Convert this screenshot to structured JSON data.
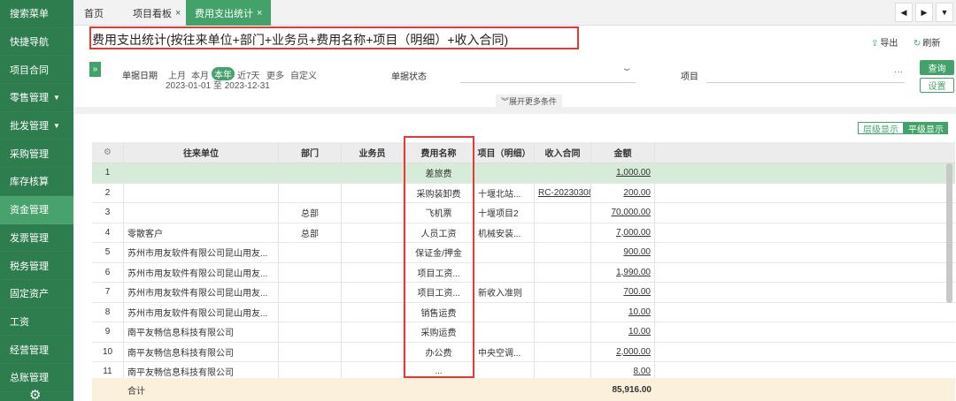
{
  "sidebar": {
    "items": [
      {
        "label": "搜索菜单",
        "caret": false,
        "active": false
      },
      {
        "label": "快捷导航",
        "caret": false,
        "active": false
      },
      {
        "label": "项目合同",
        "caret": false,
        "active": false
      },
      {
        "label": "零售管理",
        "caret": true,
        "active": false
      },
      {
        "label": "批发管理",
        "caret": true,
        "active": false
      },
      {
        "label": "采购管理",
        "caret": false,
        "active": false
      },
      {
        "label": "库存核算",
        "caret": false,
        "active": false
      },
      {
        "label": "资金管理",
        "caret": false,
        "active": true
      },
      {
        "label": "发票管理",
        "caret": false,
        "active": false
      },
      {
        "label": "税务管理",
        "caret": false,
        "active": false
      },
      {
        "label": "固定资产",
        "caret": false,
        "active": false
      },
      {
        "label": "工资",
        "caret": false,
        "active": false
      },
      {
        "label": "经营管理",
        "caret": false,
        "active": false
      },
      {
        "label": "总账管理",
        "caret": false,
        "active": false
      }
    ],
    "caret_glyph": "▼",
    "gear_glyph": "⚙"
  },
  "tabs": {
    "items": [
      {
        "label": "首页",
        "closable": false,
        "active": false
      },
      {
        "label": "项目看板",
        "closable": true,
        "active": false
      },
      {
        "label": "费用支出统计",
        "closable": true,
        "active": true
      }
    ],
    "close_glyph": "×",
    "nav": [
      "◀",
      "▶",
      "▼"
    ]
  },
  "header": {
    "title": "费用支出统计(按往来单位+部门+业务员+费用名称+项目（明细）+收入合同)",
    "export_label": "导出",
    "refresh_label": "刷新"
  },
  "filters": {
    "toggle_glyph": "»",
    "date_label": "单据日期",
    "quick_options": [
      {
        "label": "上月",
        "selected": false
      },
      {
        "label": "本月",
        "selected": false
      },
      {
        "label": "本年",
        "selected": true
      },
      {
        "label": "近7天",
        "selected": false
      },
      {
        "label": "更多",
        "selected": false
      },
      {
        "label": "自定义",
        "selected": false
      }
    ],
    "date_range": "2023-01-01 至 2023-12-31",
    "status_label": "单据状态",
    "status_value": "",
    "project_label": "项目",
    "project_value": "",
    "ellipsis": "···",
    "query_label": "查询",
    "settings_label": "设置",
    "expand_label": "展开更多条件",
    "expand_glyph": "︾"
  },
  "view_toggle": {
    "hierarchy_label": "层级显示",
    "flat_label": "平级显示",
    "active": "flat"
  },
  "table": {
    "gear_glyph": "⚙",
    "columns": [
      "",
      "往来单位",
      "部门",
      "业务员",
      "费用名称",
      "项目（明细）",
      "收入合同",
      "金额"
    ],
    "header_project_label": "项目（明细）",
    "rows": [
      {
        "no": "1",
        "partner": "",
        "dept": "",
        "staff": "",
        "expense": "差旅费",
        "project": "",
        "contract": "",
        "amount": "1,000.00",
        "selected": true
      },
      {
        "no": "2",
        "partner": "",
        "dept": "",
        "staff": "",
        "expense": "采购装卸费",
        "project": "十堰北站...",
        "contract": "RC-20230308",
        "amount": "200.00",
        "selected": false
      },
      {
        "no": "3",
        "partner": "",
        "dept": "总部",
        "staff": "",
        "expense": "飞机票",
        "project": "十堰项目2",
        "contract": "",
        "amount": "70,000.00",
        "selected": false
      },
      {
        "no": "4",
        "partner": "零散客户",
        "dept": "总部",
        "staff": "",
        "expense": "人员工资",
        "project": "机械安装...",
        "contract": "",
        "amount": "7,000.00",
        "selected": false
      },
      {
        "no": "5",
        "partner": "苏州市用友软件有限公司昆山用友...",
        "dept": "",
        "staff": "",
        "expense": "保证金/押金",
        "project": "",
        "contract": "",
        "amount": "900.00",
        "selected": false
      },
      {
        "no": "6",
        "partner": "苏州市用友软件有限公司昆山用友...",
        "dept": "",
        "staff": "",
        "expense": "项目工资...",
        "project": "",
        "contract": "",
        "amount": "1,990.00",
        "selected": false
      },
      {
        "no": "7",
        "partner": "苏州市用友软件有限公司昆山用友...",
        "dept": "",
        "staff": "",
        "expense": "项目工资...",
        "project": "新收入准则",
        "contract": "",
        "amount": "700.00",
        "selected": false
      },
      {
        "no": "8",
        "partner": "苏州市用友软件有限公司昆山用友...",
        "dept": "",
        "staff": "",
        "expense": "销售运费",
        "project": "",
        "contract": "",
        "amount": "10.00",
        "selected": false
      },
      {
        "no": "9",
        "partner": "南平友畅信息科技有限公司",
        "dept": "",
        "staff": "",
        "expense": "采购运费",
        "project": "",
        "contract": "",
        "amount": "10.00",
        "selected": false
      },
      {
        "no": "10",
        "partner": "南平友畅信息科技有限公司",
        "dept": "",
        "staff": "",
        "expense": "办公费",
        "project": "中央空调...",
        "contract": "",
        "amount": "2,000.00",
        "selected": false
      },
      {
        "no": "11",
        "partner": "南平友畅信息科技有限公司",
        "dept": "",
        "staff": "",
        "expense": "...",
        "project": "",
        "contract": "",
        "amount": "8.00",
        "selected": false
      }
    ],
    "total_label": "合计",
    "total_amount": "85,916.00"
  },
  "colors": {
    "sidebar_bg": "#2e7d4f",
    "accent": "#43a26a",
    "highlight_red": "#e53935",
    "selected_row": "#d6ecd8",
    "total_row": "#fbf0dc"
  }
}
